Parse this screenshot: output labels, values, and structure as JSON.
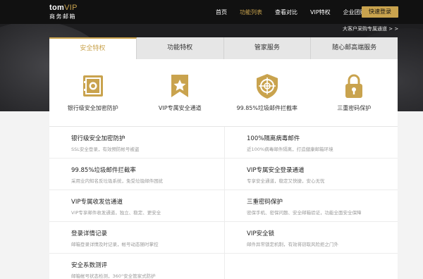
{
  "logo": {
    "brand": "tom",
    "vip": "VIP",
    "subtitle": "商务邮箱"
  },
  "nav": {
    "items": [
      "首页",
      "功能列表",
      "查看对比",
      "VIP特权",
      "企业团购"
    ],
    "active_index": 1
  },
  "quick_login": "快速登录",
  "enterprise_link": "大客户采购专属通道 > >",
  "tabs": [
    "安全特权",
    "功能特权",
    "管家服务",
    "随心邮高端服务"
  ],
  "features": [
    {
      "icon": "safe-icon",
      "label": "银行级安全加密防护"
    },
    {
      "icon": "star-ribbon-icon",
      "label": "VIP专属安全通道"
    },
    {
      "icon": "shield-target-icon",
      "label": "99.85%垃圾邮件拦截率"
    },
    {
      "icon": "padlock-icon",
      "label": "三重密码保护"
    }
  ],
  "items": [
    {
      "title": "银行级安全加密防护",
      "desc": "SSL安全登录，有效预防帐号被盗"
    },
    {
      "title": "100%隔离病毒邮件",
      "desc": "近100%病毒邮件隔离，打造健康邮箱环境"
    },
    {
      "title": "99.85%垃圾邮件拦截率",
      "desc": "采用业内知名反垃圾系统，免受垃圾邮件困扰"
    },
    {
      "title": "VIP专属安全登录通道",
      "desc": "专享安全通道，稳定又快捷，安心无忧"
    },
    {
      "title": "VIP专属收发信通道",
      "desc": "VIP专享邮件收发通道，独立、稳定、更安全"
    },
    {
      "title": "三重密码保护",
      "desc": "密保手机、密保问题、安全邮箱验证，功能全面安全保障"
    },
    {
      "title": "登录详情记录",
      "desc": "邮箱登录详情及时记录，帐号动态随时掌控"
    },
    {
      "title": "VIP安全锁",
      "desc": "邮件异常锁定机制，有效将窃取风险拒之门外"
    },
    {
      "title": "安全系数测评",
      "desc": "邮箱帐号状态检测，360°安全管家式防护"
    }
  ],
  "colors": {
    "accent": "#c9a34e",
    "dark": "#1e1e20"
  }
}
